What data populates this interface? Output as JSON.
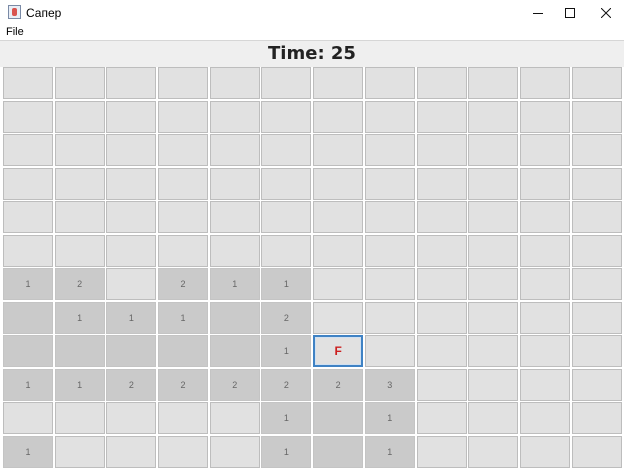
{
  "window": {
    "title": "Сапер"
  },
  "menu": {
    "items": [
      "File"
    ]
  },
  "timer": {
    "text": "Time: 25"
  },
  "board": {
    "rows": 12,
    "cols": 12,
    "cells": [
      [
        "H",
        "H",
        "H",
        "H",
        "H",
        "H",
        "H",
        "H",
        "H",
        "H",
        "H",
        "H"
      ],
      [
        "H",
        "H",
        "H",
        "H",
        "H",
        "H",
        "H",
        "H",
        "H",
        "H",
        "H",
        "H"
      ],
      [
        "H",
        "H",
        "H",
        "H",
        "H",
        "H",
        "H",
        "H",
        "H",
        "H",
        "H",
        "H"
      ],
      [
        "H",
        "H",
        "H",
        "H",
        "H",
        "H",
        "H",
        "H",
        "H",
        "H",
        "H",
        "H"
      ],
      [
        "H",
        "H",
        "H",
        "H",
        "H",
        "H",
        "H",
        "H",
        "H",
        "H",
        "H",
        "H"
      ],
      [
        "H",
        "H",
        "H",
        "H",
        "H",
        "H",
        "H",
        "H",
        "H",
        "H",
        "H",
        "H"
      ],
      [
        "1",
        "2",
        "H",
        "2",
        "1",
        "1",
        "H",
        "H",
        "H",
        "H",
        "H",
        "H"
      ],
      [
        "0",
        "1",
        "1",
        "1",
        "0",
        "2",
        "H",
        "H",
        "H",
        "H",
        "H",
        "H"
      ],
      [
        "0",
        "0",
        "0",
        "0",
        "0",
        "1",
        "F",
        "H",
        "H",
        "H",
        "H",
        "H"
      ],
      [
        "1",
        "1",
        "2",
        "2",
        "2",
        "2",
        "2",
        "3",
        "H",
        "H",
        "H",
        "H"
      ],
      [
        "H",
        "H",
        "H",
        "H",
        "H",
        "1",
        "0",
        "1",
        "H",
        "H",
        "H",
        "H"
      ],
      [
        "1",
        "H",
        "H",
        "H",
        "H",
        "1",
        "0",
        "1",
        "H",
        "H",
        "H",
        "H"
      ]
    ]
  }
}
